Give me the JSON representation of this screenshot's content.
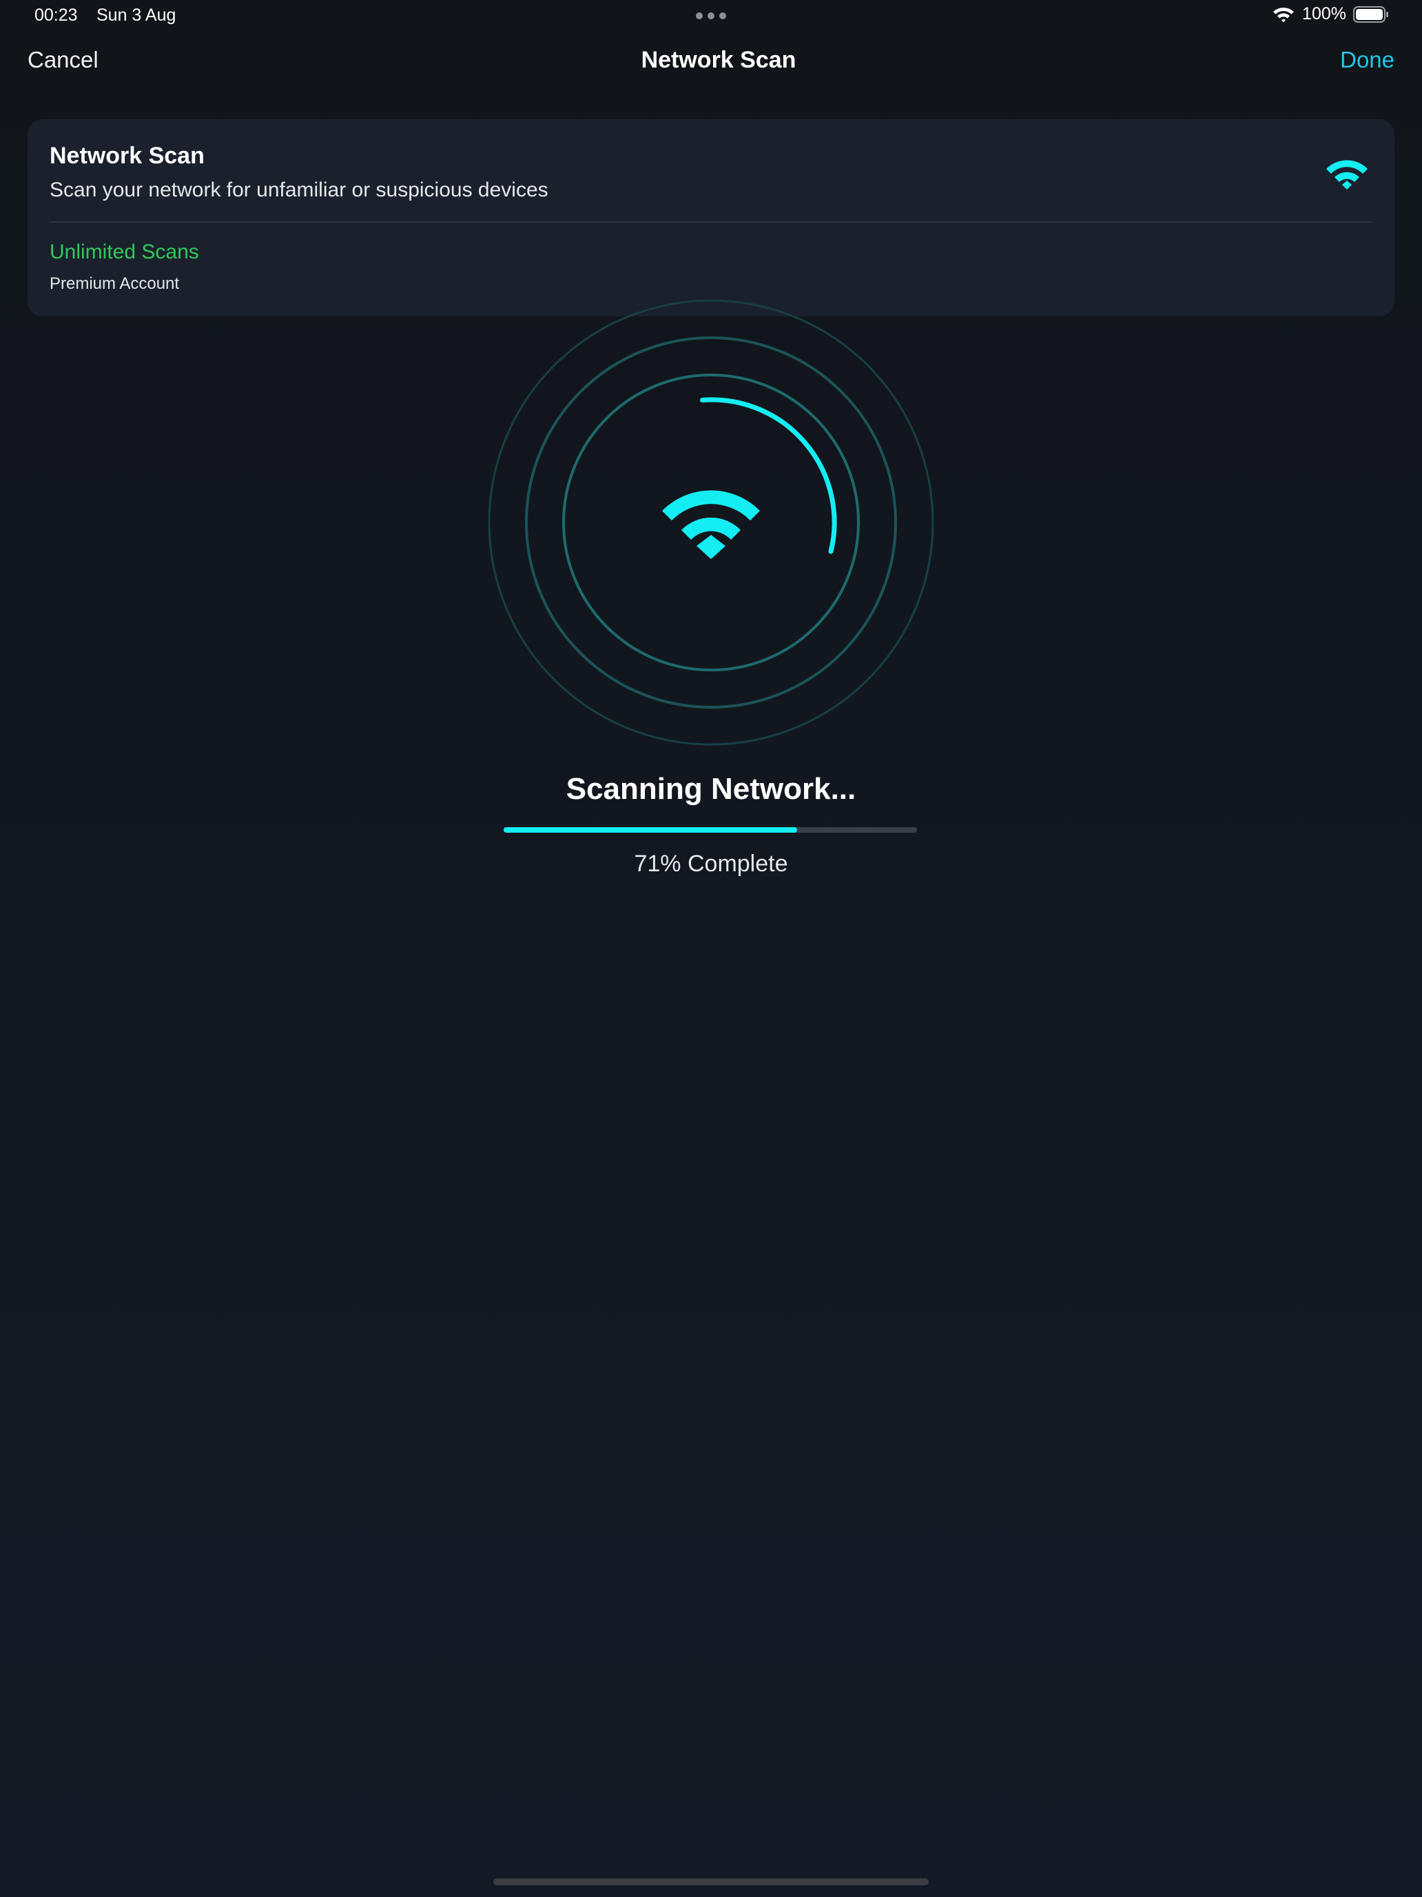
{
  "status_bar": {
    "time": "00:23",
    "date": "Sun 3 Aug",
    "battery": "100%",
    "icons": [
      "wifi-icon",
      "battery-icon",
      "multitask-dots-icon"
    ]
  },
  "nav": {
    "cancel_label": "Cancel",
    "title": "Network Scan",
    "done_label": "Done"
  },
  "card": {
    "title": "Network Scan",
    "subtitle": "Scan your network for unfamiliar or suspicious devices",
    "plan": "Unlimited Scans",
    "account": "Premium Account",
    "icon": "wifi-icon"
  },
  "scan": {
    "title": "Scanning Network...",
    "progress": 0.71,
    "percent_label": "71% Complete"
  },
  "colors": {
    "accent": "#14eef2",
    "done": "#1fc7ea",
    "plan_green": "#2fc95a",
    "card_bg": "#1b212c",
    "ring": "#1d6a6e"
  }
}
